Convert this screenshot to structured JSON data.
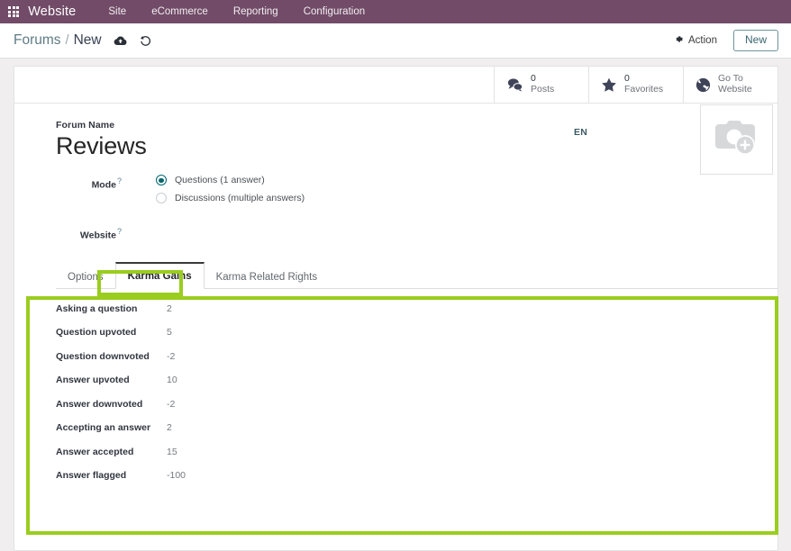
{
  "navbar": {
    "apps_icon": "apps-grid-icon",
    "brand": "Website",
    "menu": [
      "Site",
      "eCommerce",
      "Reporting",
      "Configuration"
    ]
  },
  "control_panel": {
    "breadcrumb_root": "Forums",
    "breadcrumb_separator": "/",
    "breadcrumb_current": "New",
    "save_icon": "cloud-upload-icon",
    "discard_icon": "undo-icon",
    "action_label": "Action",
    "action_icon": "gear-icon",
    "new_label": "New"
  },
  "stat_buttons": [
    {
      "value": "0",
      "label": "Posts",
      "icon": "comments-icon"
    },
    {
      "value": "0",
      "label": "Favorites",
      "icon": "star-icon"
    },
    {
      "value": "Go To",
      "label": "Website",
      "icon": "globe-icon"
    }
  ],
  "form": {
    "forum_name_label": "Forum Name",
    "forum_name_value": "Reviews",
    "language_badge": "EN",
    "image_placeholder_icon": "camera-add-icon",
    "mode_label": "Mode",
    "help_marker": "?",
    "mode_options": [
      {
        "label": "Questions (1 answer)",
        "selected": true
      },
      {
        "label": "Discussions (multiple answers)",
        "selected": false
      }
    ],
    "website_label": "Website"
  },
  "tabs": [
    {
      "label": "Options",
      "active": false
    },
    {
      "label": "Karma Gains",
      "active": true
    },
    {
      "label": "Karma Related Rights",
      "active": false
    }
  ],
  "karma_gains": [
    {
      "label": "Asking a question",
      "value": "2"
    },
    {
      "label": "Question upvoted",
      "value": "5"
    },
    {
      "label": "Question downvoted",
      "value": "-2"
    },
    {
      "label": "Answer upvoted",
      "value": "10"
    },
    {
      "label": "Answer downvoted",
      "value": "-2"
    },
    {
      "label": "Accepting an answer",
      "value": "2"
    },
    {
      "label": "Answer accepted",
      "value": "15"
    },
    {
      "label": "Answer flagged",
      "value": "-100"
    }
  ],
  "annotations": {
    "highlight_color": "#9ACD1E",
    "tab_highlight_target": "Karma Gains",
    "area_highlight_target": "Karma Gains panel"
  },
  "colors": {
    "navbar_purple": "#714B67",
    "accent_teal": "#01666d",
    "page_bg": "#f0eeee"
  }
}
